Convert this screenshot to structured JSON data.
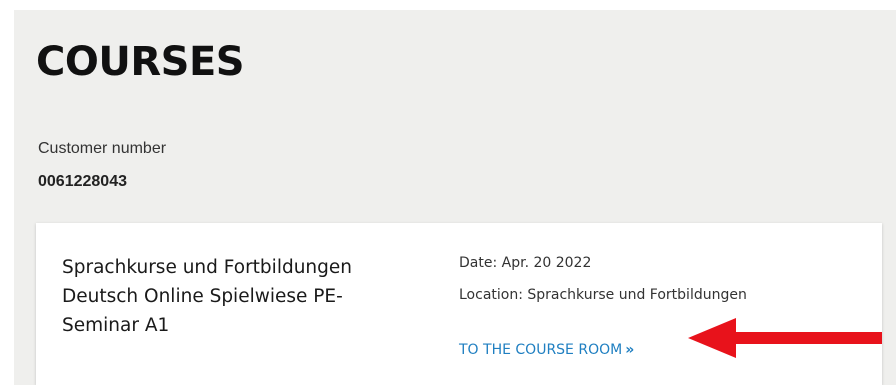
{
  "page": {
    "title": "COURSES"
  },
  "customer": {
    "label": "Customer number",
    "number": "0061228043"
  },
  "course": {
    "name_lines": [
      "Sprachkurse und Fortbildungen",
      "Deutsch Online Spielwiese PE-",
      "Seminar A1"
    ],
    "date": "Date: Apr. 20 2022",
    "location": "Location: Sprachkurse und Fortbildungen",
    "link_label": "TO THE COURSE ROOM",
    "link_icon": "double-chevron-right-icon"
  },
  "annotation": {
    "arrow_color": "#e8121b",
    "link_color": "#1f7fc1",
    "background_color": "#efefed"
  }
}
